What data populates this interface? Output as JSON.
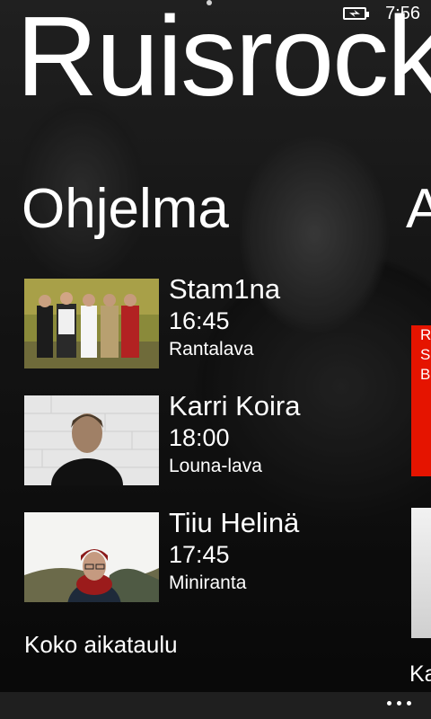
{
  "status_bar": {
    "time": "7:56"
  },
  "app": {
    "title": "Ruisrock"
  },
  "panorama": {
    "section_title": "Ohjelma",
    "next_section_title": "A"
  },
  "program": [
    {
      "artist": "Stam1na",
      "time": "16:45",
      "stage": "Rantalava"
    },
    {
      "artist": "Karri Koira",
      "time": "18:00",
      "stage": "Louna-lava"
    },
    {
      "artist": "Tiiu Helinä",
      "time": "17:45",
      "stage": "Miniranta"
    }
  ],
  "more_link": "Koko aikataulu",
  "peek": {
    "lines": [
      "R",
      "S",
      "B"
    ],
    "label": "Ka"
  },
  "colors": {
    "accent": "#e51400",
    "app_bar": "#1f1f1f"
  }
}
